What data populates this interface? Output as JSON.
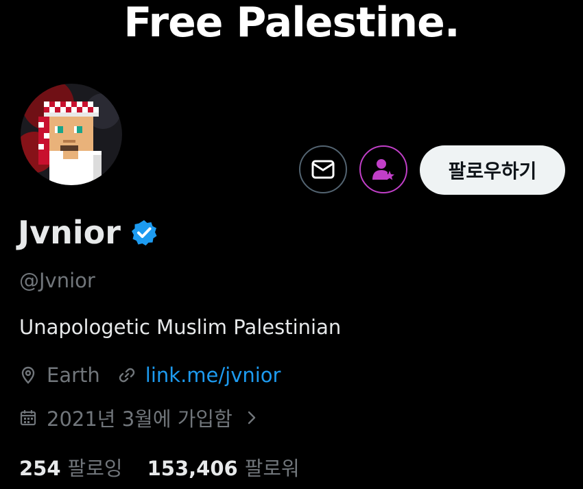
{
  "banner": {
    "text": "Free Palestine."
  },
  "profile": {
    "name": "Jvnior",
    "handle": "@Jvnior",
    "bio": "Unapologetic Muslim Palestinian",
    "location": "Earth",
    "website": "link.me/jvnior",
    "joined": "2021년 3월에 가입함"
  },
  "actions": {
    "follow_label": "팔로우하기"
  },
  "stats": {
    "following_count": "254",
    "following_label": "팔로잉",
    "followers_count": "153,406",
    "followers_label": "팔로워"
  },
  "icons": {
    "message": "envelope-icon",
    "subscribe": "person-star-icon",
    "verified": "verified-badge-icon",
    "location": "location-pin-icon",
    "link": "link-icon",
    "calendar": "calendar-icon",
    "chevron": "chevron-right-icon"
  },
  "colors": {
    "background": "#000000",
    "text": "#e7e9ea",
    "secondary_text": "#71767b",
    "link": "#1d9bf0",
    "subscribe_accent": "#c13fc8",
    "follow_button_bg": "#eff3f4"
  }
}
